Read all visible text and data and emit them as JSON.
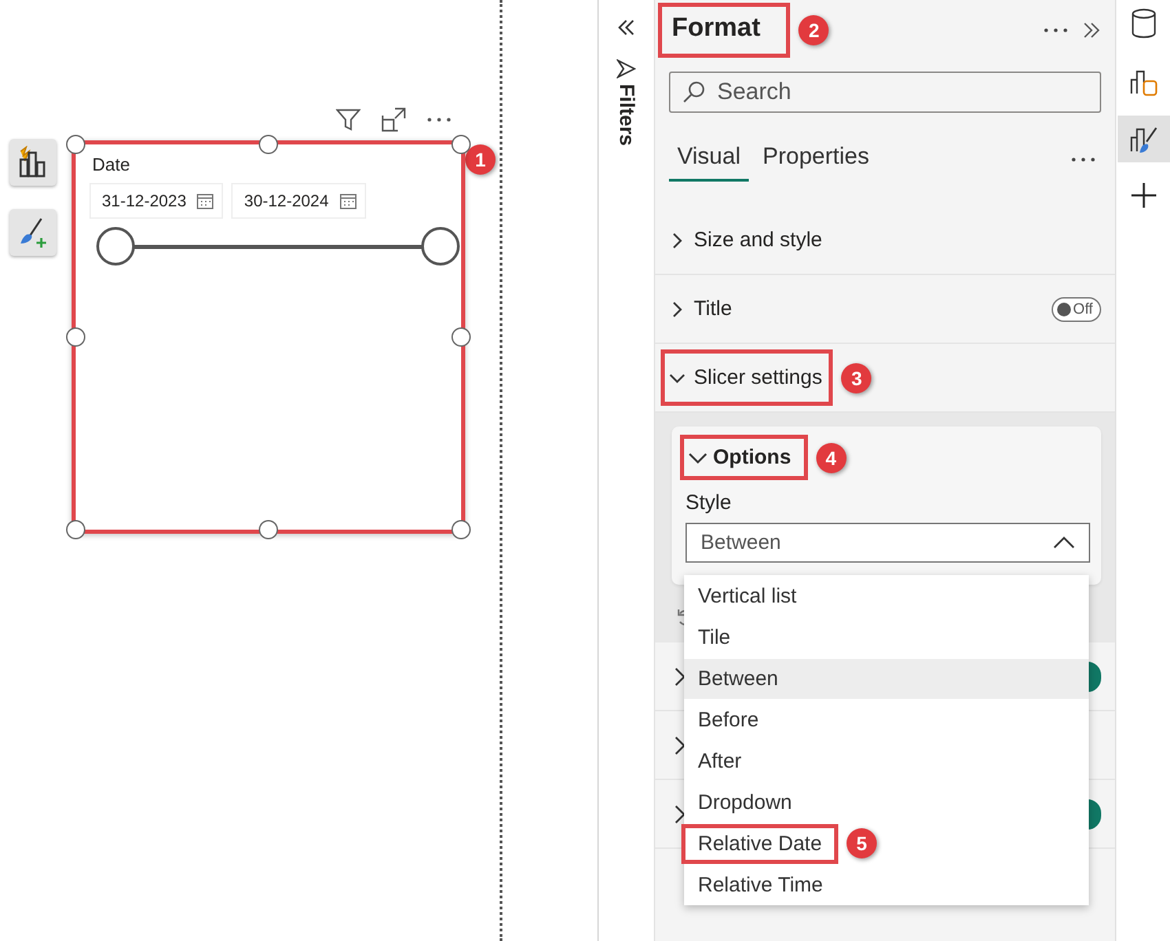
{
  "slicer": {
    "title": "Date",
    "start_date": "31-12-2023",
    "end_date": "30-12-2024",
    "callout": "1",
    "slider": {
      "level": 1
    }
  },
  "filters_pane": {
    "label": "Filters"
  },
  "format_pane": {
    "title": "Format",
    "title_callout": "2",
    "search": {
      "placeholder": "Search"
    },
    "tabs": [
      {
        "label": "Visual",
        "selected": true
      },
      {
        "label": "Properties",
        "selected": false
      }
    ],
    "sections": [
      {
        "label": "Size and style",
        "expanded": false
      },
      {
        "label": "Title",
        "expanded": false,
        "toggle": {
          "on": false,
          "label": "Off"
        }
      },
      {
        "label": "Slicer settings",
        "expanded": true,
        "callout": "3"
      }
    ],
    "options": {
      "label": "Options",
      "expanded": true,
      "callout": "4",
      "style_label": "Style",
      "style_value": "Between",
      "dropdown_open": true,
      "choices": [
        {
          "label": "Vertical list",
          "selected": false
        },
        {
          "label": "Tile",
          "selected": false
        },
        {
          "label": "Between",
          "selected": true
        },
        {
          "label": "Before",
          "selected": false
        },
        {
          "label": "After",
          "selected": false
        },
        {
          "label": "Dropdown",
          "selected": false
        },
        {
          "label": "Relative Date",
          "selected": false,
          "callout": "5"
        },
        {
          "label": "Relative Time",
          "selected": false
        }
      ]
    },
    "sections_below": [
      {
        "kind": "toggle",
        "on": true
      },
      {
        "kind": "plain"
      },
      {
        "kind": "toggle",
        "on": true
      }
    ]
  }
}
